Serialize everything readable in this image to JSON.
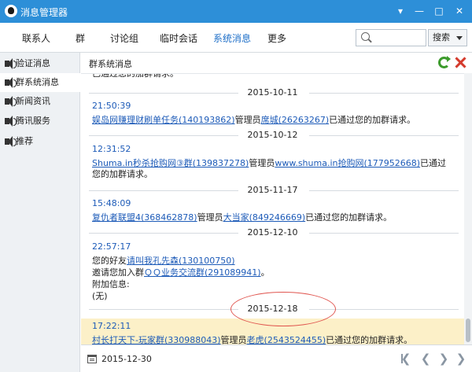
{
  "window": {
    "title": "消息管理器",
    "controls": {
      "menu": "▾",
      "minimize": "—",
      "maximize": "□",
      "close": "✕"
    }
  },
  "tabs": [
    "联系人",
    "群",
    "讨论组",
    "临时会话",
    "系统消息",
    "更多"
  ],
  "active_tab": "系统消息",
  "search": {
    "placeholder": "",
    "button_label": "搜索"
  },
  "sidebar": {
    "items": [
      {
        "label": "验证消息",
        "active": false
      },
      {
        "label": "群系统消息",
        "active": true
      },
      {
        "label": "新闻资讯",
        "active": false
      },
      {
        "label": "腾讯服务",
        "active": false
      },
      {
        "label": "推荐",
        "active": false
      }
    ]
  },
  "panel": {
    "title": "群系统消息"
  },
  "feed": {
    "top_partial": "已通过您的加群请求。",
    "blocks": [
      {
        "date": "2015-10-11",
        "time": "21:50:39",
        "group_link": "娱岛网赚理财刷单任务(140193862)",
        "mid1": "管理员",
        "admin_link": "席城(26263267)",
        "tail": "已通过您的加群请求。"
      },
      {
        "date": "2015-10-12",
        "time": "12:31:52",
        "group_link": "Shuma.in秒杀抢购网③群(139837278)",
        "mid1": "管理员",
        "admin_link": "www.shuma.in抢购网(177952668)",
        "tail": "已通过您的加群请求。"
      },
      {
        "date": "2015-11-17",
        "time": "15:48:09",
        "group_link": "复仇者联盟4(368462878)",
        "mid1": "管理员",
        "admin_link": "大当家(849246669)",
        "tail": "已通过您的加群请求。"
      },
      {
        "date": "2015-12-10",
        "time": "22:57:17",
        "friend_prefix": "您的好友",
        "friend_link": "请叫我孔先森(130100750)",
        "invite_prefix": "邀请您加入群",
        "invite_link": "ＱＱ业务交流群(291089941)",
        "invite_suffix": "。",
        "extra_label": "附加信息:",
        "extra_value": "(无)"
      },
      {
        "date": "2015-12-18",
        "time": "17:22:11",
        "group_link": "村长打天下-玩家群(330988043)",
        "mid1": "管理员",
        "admin_link": "老虎(2543524455)",
        "tail": "已通过您的加群请求。"
      }
    ]
  },
  "footer": {
    "date": "2015-12-30",
    "nav": {
      "first": "❮",
      "prev": "❮",
      "next": "❯",
      "last": "❯"
    }
  },
  "colors": {
    "titlebar": "#2d8fd8",
    "link": "#1d5bb8",
    "highlight": "#fcf0c8",
    "annotation_circle": "#e0554f"
  },
  "icons": [
    "qq-penguin-icon",
    "search-icon",
    "speaker-icon",
    "refresh-icon",
    "delete-x-icon",
    "calendar-icon",
    "first-page-icon",
    "prev-page-icon",
    "next-page-icon",
    "last-page-icon"
  ]
}
